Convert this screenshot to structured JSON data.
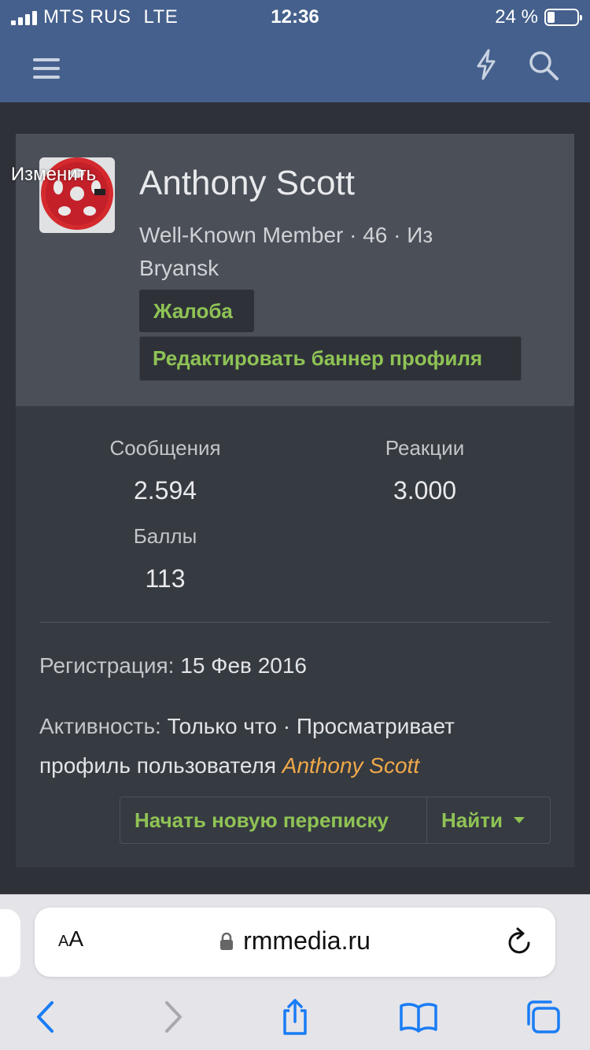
{
  "status_bar": {
    "carrier": "MTS RUS",
    "network": "LTE",
    "time": "12:36",
    "battery_text": "24 %",
    "battery_level": 0.24
  },
  "header": {
    "menu_icon": "hamburger-menu-icon",
    "bolt_icon": "lightning-bolt-icon",
    "search_icon": "search-icon",
    "background_color": "#45608c"
  },
  "profile": {
    "avatar_change_label": "Изменить",
    "name": "Anthony Scott",
    "meta_line": "Well-Known Member · 46 · Из Bryansk",
    "report_label": "Жалоба",
    "edit_banner_label": "Редактировать баннер профиля",
    "stats": [
      {
        "label": "Сообщения",
        "value": "2.594"
      },
      {
        "label": "Реакции",
        "value": "3.000"
      },
      {
        "label": "Баллы",
        "value": "113"
      }
    ],
    "registration_label": "Регистрация:",
    "registration_value": "15 Фев 2016",
    "activity_label": "Активность:",
    "activity_value": "Только что · Просматривает профиль пользователя",
    "activity_user": "Anthony Scott",
    "start_conversation_label": "Начать новую переписку",
    "find_label": "Найти"
  },
  "browser": {
    "aa_label_small": "A",
    "aa_label_large": "A",
    "url": "rmmedia.ru"
  },
  "colors": {
    "accent_green": "#8fc355",
    "link_orange": "#f0a94a"
  }
}
